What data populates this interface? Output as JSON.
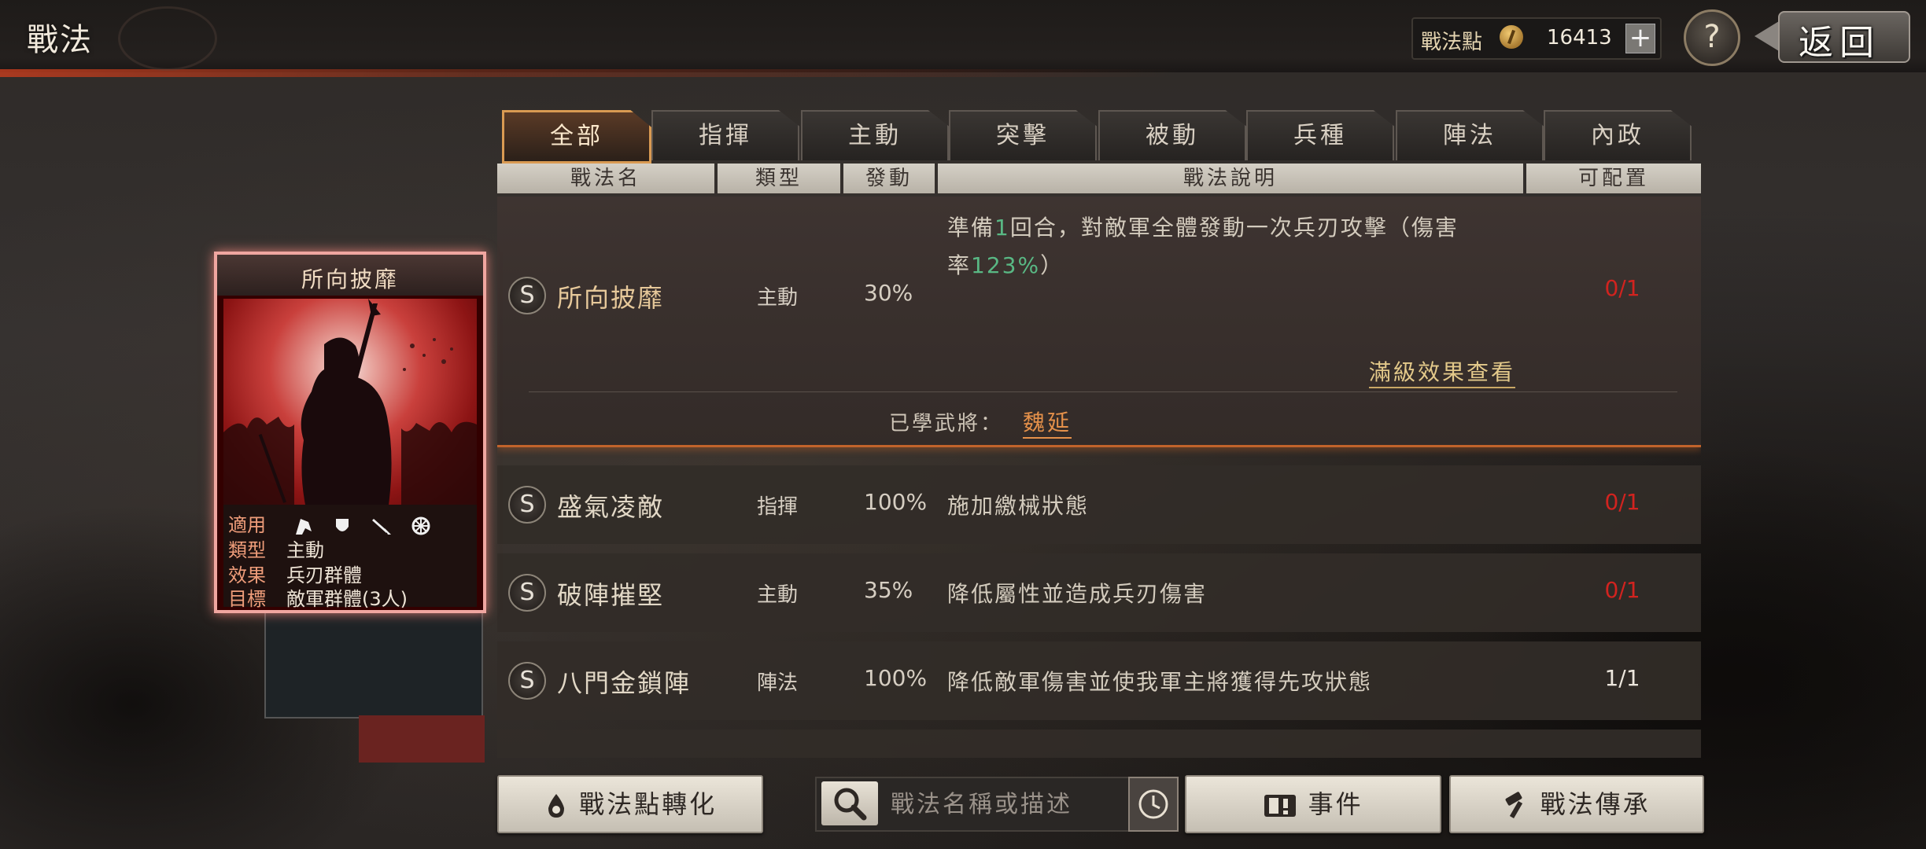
{
  "header": {
    "title": "戰法",
    "points_label": "戰法點",
    "points_value": "16413",
    "plus": "+",
    "help": "?",
    "back": "返回"
  },
  "tabs": [
    {
      "label": "全部",
      "active": true
    },
    {
      "label": "指揮",
      "active": false
    },
    {
      "label": "主動",
      "active": false
    },
    {
      "label": "突擊",
      "active": false
    },
    {
      "label": "被動",
      "active": false
    },
    {
      "label": "兵種",
      "active": false
    },
    {
      "label": "陣法",
      "active": false
    },
    {
      "label": "內政",
      "active": false
    }
  ],
  "columns": {
    "name": "戰法名",
    "type": "類型",
    "trigger": "發動",
    "description": "戰法說明",
    "available": "可配置"
  },
  "rows": [
    {
      "badge": "S",
      "name": "所向披靡",
      "type": "主動",
      "rate": "30%",
      "desc_line1_a": "準備",
      "desc_line1_num": "1",
      "desc_line1_b": "回合，對敵軍全體發動一次兵刃攻擊（傷害",
      "desc_line2_a": "率",
      "desc_line2_num": "123%",
      "desc_line2_b": "）",
      "count": "0/1",
      "max_effect_link": "滿級效果查看",
      "learned_label": "已學武將：",
      "learned_general": "魏延"
    },
    {
      "badge": "S",
      "name": "盛氣凌敵",
      "type": "指揮",
      "rate": "100%",
      "desc": "施加繳械狀態",
      "count": "0/1"
    },
    {
      "badge": "S",
      "name": "破陣摧堅",
      "type": "主動",
      "rate": "35%",
      "desc": "降低屬性並造成兵刃傷害",
      "count": "0/1"
    },
    {
      "badge": "S",
      "name": "八門金鎖陣",
      "type": "陣法",
      "rate": "100%",
      "desc": "降低敵軍傷害並使我軍主將獲得先攻狀態",
      "count": "1/1"
    }
  ],
  "card": {
    "title": "所向披靡",
    "applies_label": "適用",
    "applies_icons": [
      "cavalry-icon",
      "shield-icon",
      "archer-icon",
      "siege-wheel-icon"
    ],
    "type_label": "類型",
    "type_value": "主動",
    "effect_label": "效果",
    "effect_value": "兵刃群體",
    "target_label": "目標",
    "target_value": "敵軍群體(3人)"
  },
  "bottom": {
    "convert_button": "戰法點轉化",
    "search_placeholder": "戰法名稱或描述",
    "events_button": "事件",
    "inherit_button": "戰法傳承"
  },
  "colors": {
    "accent_orange": "#d99a52",
    "count_red": "#d1231f",
    "number_green": "#59b884",
    "learned_orange": "#e5914a"
  }
}
